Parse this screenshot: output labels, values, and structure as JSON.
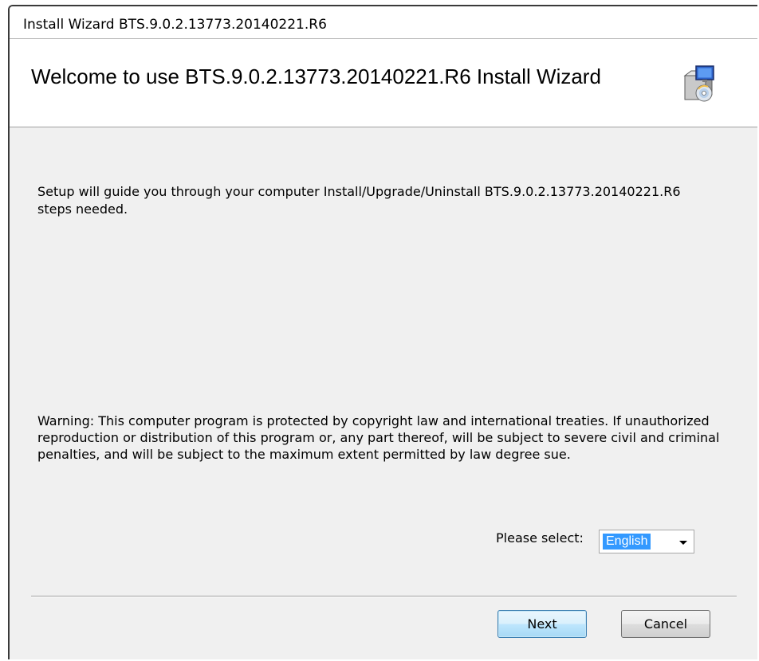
{
  "window": {
    "title": "Install Wizard BTS.9.0.2.13773.20140221.R6"
  },
  "header": {
    "title": "Welcome to use BTS.9.0.2.13773.20140221.R6 Install Wizard",
    "icon": "installer-icon"
  },
  "content": {
    "intro": "Setup will guide you through your computer Install/Upgrade/Uninstall BTS.9.0.2.13773.20140221.R6 steps needed.",
    "warning": "Warning: This computer program is protected by copyright law and international treaties. If unauthorized reproduction or distribution of this program or, any part thereof, will be subject to severe civil and criminal penalties, and will be subject to the maximum extent permitted by law degree sue."
  },
  "language": {
    "label": "Please select:",
    "selected": "English",
    "icon": "chevron-down-icon"
  },
  "buttons": {
    "next": "Next",
    "cancel": "Cancel"
  },
  "colors": {
    "selection_highlight": "#3399ff",
    "default_button_border": "#3c7fb1",
    "dialog_background": "#f0f0f0"
  }
}
